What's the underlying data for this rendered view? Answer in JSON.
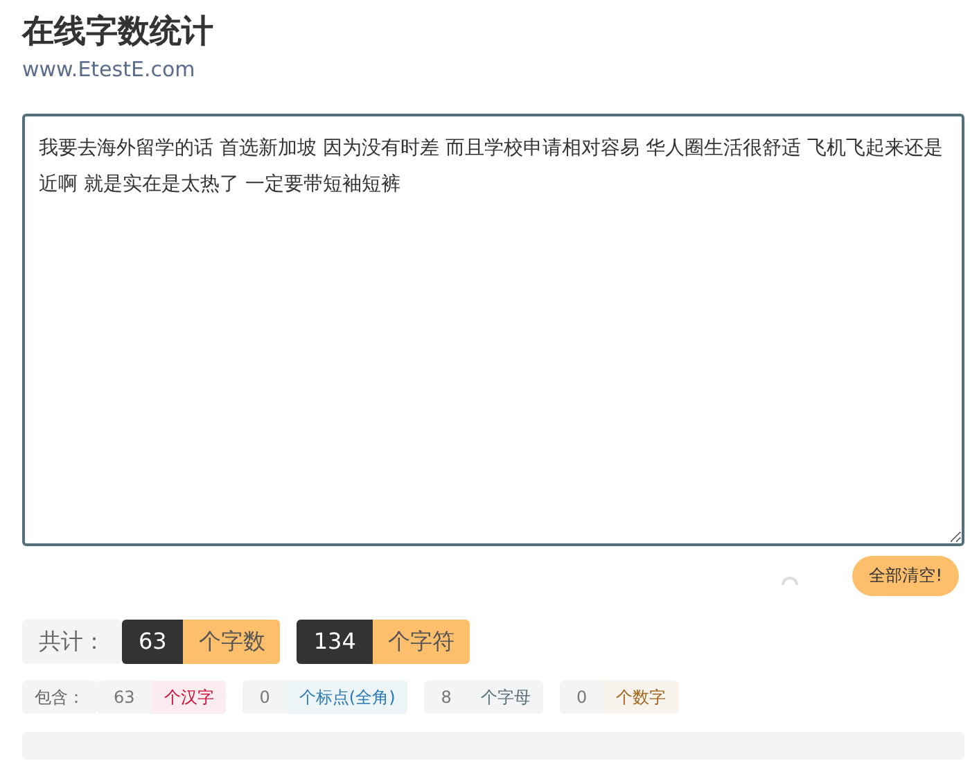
{
  "header": {
    "title": "在线字数统计",
    "site": "www.EtestE.com"
  },
  "editor": {
    "value": "我要去海外留学的话 首选新加坡 因为没有时差 而且学校申请相对容易 华人圈生活很舒适 飞机飞起来还是近啊 就是实在是太热了 一定要带短袖短裤"
  },
  "clear_button": "全部清空!",
  "totals": {
    "label": "共计：",
    "items": [
      {
        "count": "63",
        "unit": "个字数"
      },
      {
        "count": "134",
        "unit": "个字符"
      }
    ]
  },
  "breakdown": {
    "label": "包含：",
    "items": [
      {
        "count": "63",
        "unit": "个汉字",
        "color": "#d0103a"
      },
      {
        "count": "0",
        "unit": "个标点(全角)",
        "color": "#2a7ab8"
      },
      {
        "count": "8",
        "unit": "个字母",
        "color": "#5a6f7a"
      },
      {
        "count": "0",
        "unit": "个数字",
        "color": "#a0651a"
      }
    ]
  }
}
